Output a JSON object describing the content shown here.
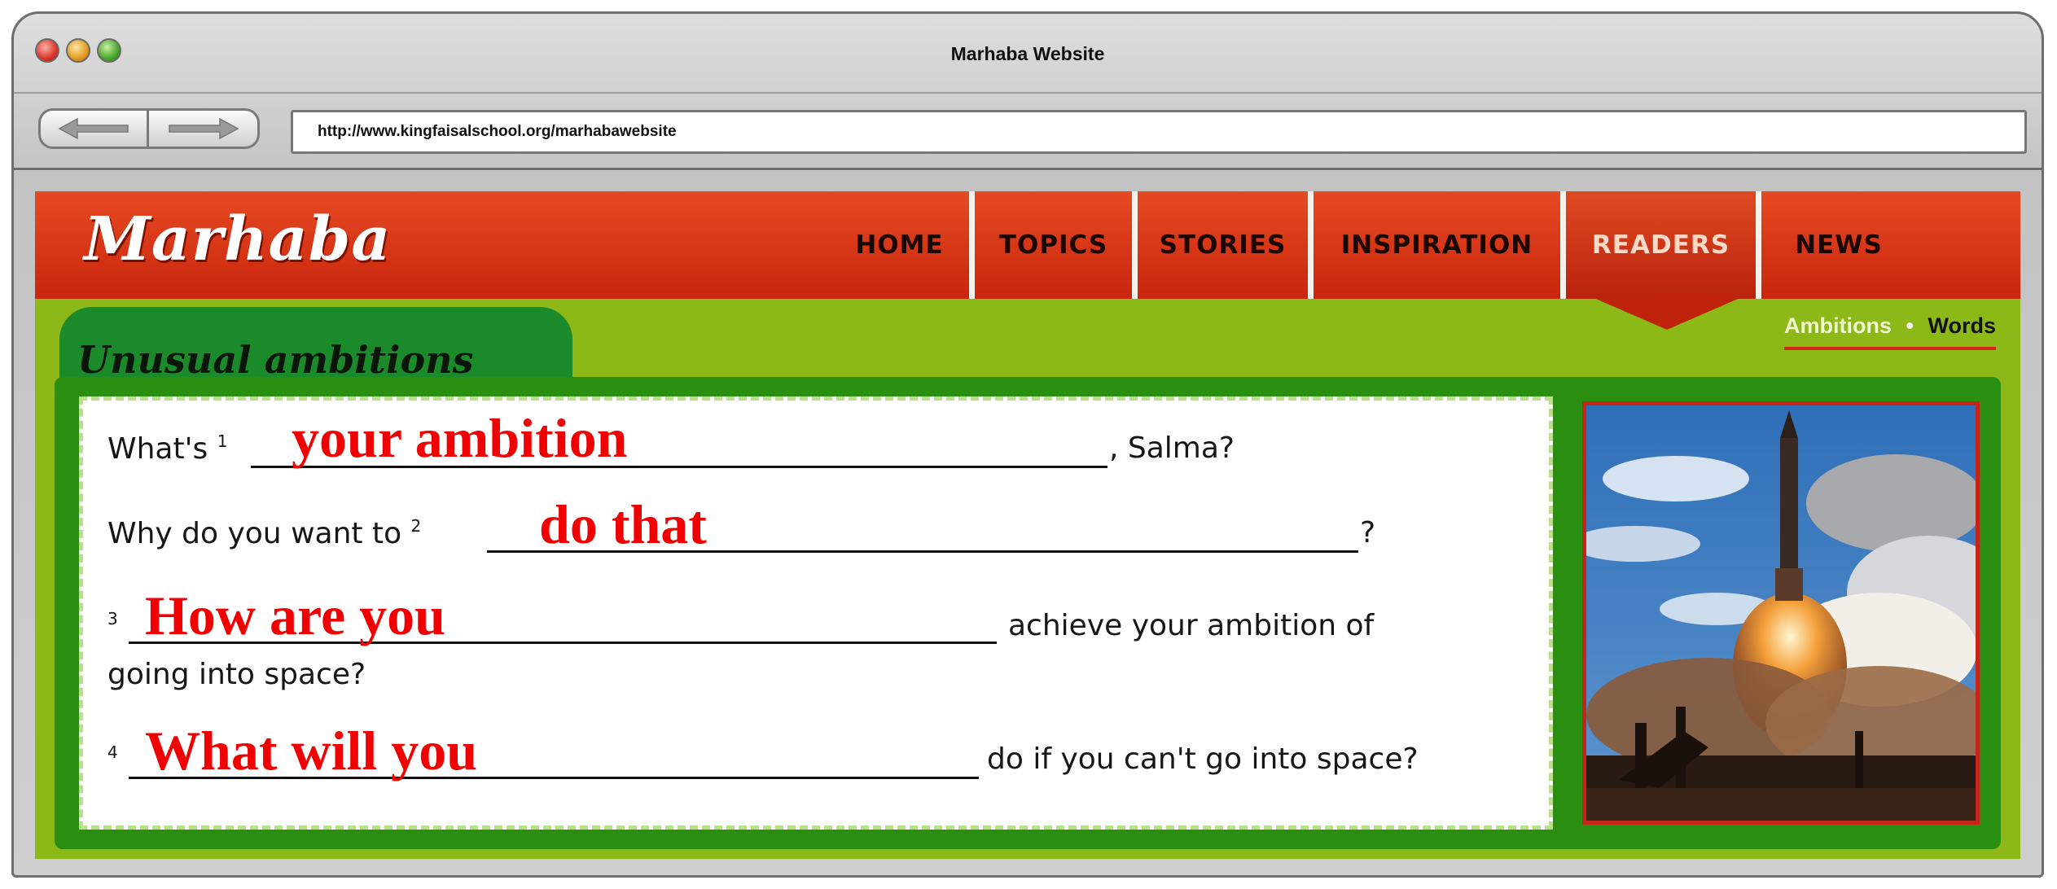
{
  "window": {
    "title": "Marhaba Website"
  },
  "toolbar": {
    "url": "http://www.kingfaisalschool.org/marhabawebsite"
  },
  "site": {
    "logo": "Marhaba",
    "nav": [
      "HOME",
      "TOPICS",
      "STORIES",
      "INSPIRATION",
      "READERS",
      "NEWS"
    ],
    "active_nav": "READERS",
    "subnav": {
      "current": "Ambitions",
      "separator": "•",
      "other": "Words"
    }
  },
  "section": {
    "tab_title": "Unusual ambitions"
  },
  "exercise": {
    "q1": {
      "num": "1",
      "before": "What's",
      "after": ", Salma?",
      "answer": "your ambition"
    },
    "q2": {
      "num": "2",
      "before": "Why do you want to",
      "after": "?",
      "answer": "do that"
    },
    "q3": {
      "num": "3",
      "after": "achieve your ambition of",
      "line2": "going into space?",
      "answer": "How are you"
    },
    "q4": {
      "num": "4",
      "after": "do if you can't go into space?",
      "answer": "What will you"
    }
  },
  "image": {
    "icon": "rocket-launch-photo"
  },
  "colors": {
    "header_red": "#d4301a",
    "page_green": "#8cb818",
    "content_green": "#2a8f10",
    "answer_red": "#f00000"
  }
}
